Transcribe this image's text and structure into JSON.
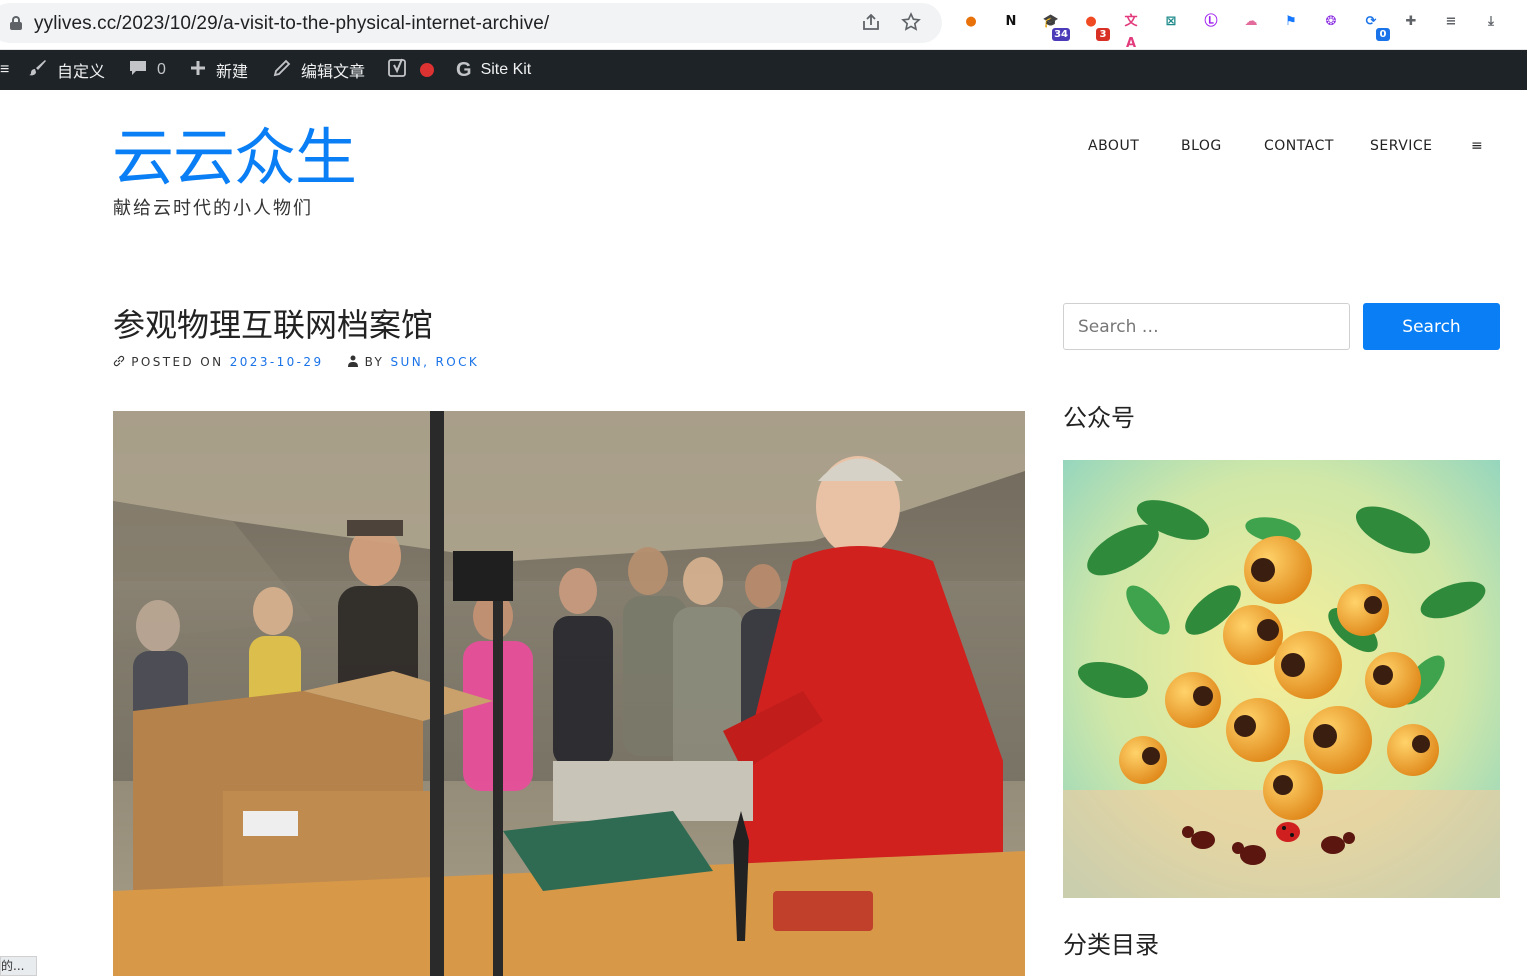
{
  "browser": {
    "url": "yylives.cc/2023/10/29/a-visit-to-the-physical-internet-archive/",
    "extensions": [
      {
        "name": "circle-ext-icon",
        "glyph": "●",
        "color": "#e8710a",
        "badge": ""
      },
      {
        "name": "notion-ext-icon",
        "glyph": "N",
        "color": "#111111",
        "badge": ""
      },
      {
        "name": "graduation-ext-icon",
        "glyph": "🎓",
        "color": "#4b3bb8",
        "badge": "34"
      },
      {
        "name": "bubbles-ext-icon",
        "glyph": "●",
        "color": "#f04a23",
        "badge": "3"
      },
      {
        "name": "translate-ext-icon",
        "glyph": "文A",
        "color": "#e23a7c",
        "badge": ""
      },
      {
        "name": "grid-ext-icon",
        "glyph": "⊠",
        "color": "#1f8a8a",
        "badge": ""
      },
      {
        "name": "lr-ext-icon",
        "glyph": "Ⓛ",
        "color": "#a020f0",
        "badge": ""
      },
      {
        "name": "cloud-ext-icon",
        "glyph": "☁",
        "color": "#e26b9b",
        "badge": ""
      },
      {
        "name": "flag-ext-icon",
        "glyph": "⚑",
        "color": "#1677ff",
        "badge": ""
      },
      {
        "name": "openai-ext-icon",
        "glyph": "❂",
        "color": "#8a2be2",
        "badge": ""
      },
      {
        "name": "sync-ext-icon",
        "glyph": "⟳",
        "color": "#1a73e8",
        "badge": "0"
      },
      {
        "name": "puzzle-ext-icon",
        "glyph": "✚",
        "color": "#5f6368",
        "badge": ""
      },
      {
        "name": "playlist-icon",
        "glyph": "≡",
        "color": "#5f6368",
        "badge": ""
      },
      {
        "name": "download-icon",
        "glyph": "⤓",
        "color": "#5f6368",
        "badge": ""
      }
    ]
  },
  "adminbar": {
    "menu_glyph": "≡",
    "customize": "自定义",
    "comments_count": "0",
    "new": "新建",
    "edit": "编辑文章",
    "sitekit": "Site Kit"
  },
  "site": {
    "title": "云云众生",
    "description": "献给云时代的小人物们"
  },
  "nav": {
    "items": [
      "ABOUT",
      "BLOG",
      "CONTACT",
      "SERVICE"
    ],
    "more": "≡"
  },
  "post": {
    "title": "参观物理互联网档案馆",
    "posted_on_label": "POSTED ON",
    "date": "2023-10-29",
    "by_label": "BY",
    "author": "SUN, ROCK"
  },
  "sidebar": {
    "search_placeholder": "Search …",
    "search_button": "Search",
    "widget1_title": "公众号",
    "widget2_title": "分类目录"
  },
  "status": {
    "text": "的..."
  },
  "colors": {
    "accent": "#0a7ff5",
    "adminbar": "#1d2327",
    "link": "#1a73e8"
  }
}
